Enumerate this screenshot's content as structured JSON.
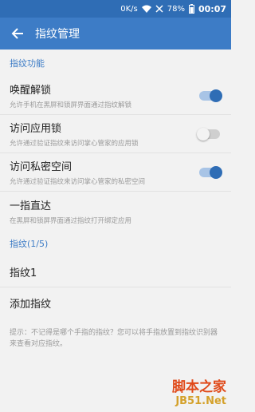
{
  "status_bar": {
    "net_speed": "0K/s",
    "battery": "78%",
    "time": "00:07"
  },
  "app_bar": {
    "title": "指纹管理"
  },
  "sections": {
    "function_header": "指纹功能",
    "fingerprint_header": "指纹(1/5)"
  },
  "items": {
    "wake_unlock": {
      "title": "唤醒解锁",
      "subtitle": "允许手机在黑屏和锁屏界面通过指纹解锁",
      "enabled": true
    },
    "app_lock": {
      "title": "访问应用锁",
      "subtitle": "允许通过验证指纹来访问掌心管家的应用锁",
      "enabled": false
    },
    "private_space": {
      "title": "访问私密空间",
      "subtitle": "允许通过验证指纹来访问掌心管家的私密空间",
      "enabled": true
    },
    "one_finger": {
      "title": "一指直达",
      "subtitle": "在黑屏和锁屏界面通过指纹打开绑定应用"
    },
    "fingerprint1": {
      "title": "指纹1"
    },
    "add_fingerprint": {
      "title": "添加指纹"
    }
  },
  "hint": "提示：不记得是哪个手指的指纹？您可以将手指放置到指纹识别器来查看对应指纹。",
  "watermark": {
    "line1": "脚本之家",
    "line2": "JB51.Net"
  },
  "colors": {
    "status_bar": "#2f6db5",
    "app_bar": "#3d7cc6",
    "accent": "#3d7cc6",
    "background": "#f2f2f2"
  }
}
